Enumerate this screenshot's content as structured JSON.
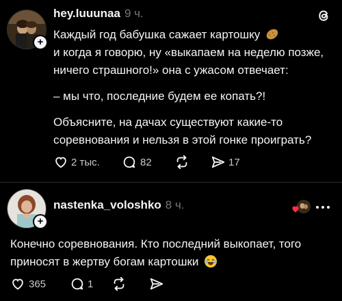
{
  "post": {
    "username": "hey.luuunaa",
    "time": "9 ч.",
    "lines": [
      "Каждый год бабушка сажает картошку",
      "и когда я говорю, ну «выкапаем на неделю позже,",
      "ничего страшного!» она с ужасом отвечает:",
      "– мы что, последние будем ее копать?!",
      "Объясните, на дачах существуют какие-то",
      "соревнования и нельзя в этой гонке проиграть?"
    ],
    "likes": "2 тыс.",
    "replies": "82",
    "shares": "17",
    "emoji_icon": "potato-emoji-icon"
  },
  "reply": {
    "username": "nastenka_voloshko",
    "time": "8 ч.",
    "lines": [
      "Конечно соревнования. Кто последний выкопает, того",
      "приносят в жертву богам картошки"
    ],
    "likes": "365",
    "replies": "1",
    "emoji_icon": "laughing-crying-emoji-icon"
  },
  "colors": {
    "background": "#000000",
    "text": "#f3f5f7",
    "muted": "#777777",
    "like_heart": "#ff3040"
  }
}
